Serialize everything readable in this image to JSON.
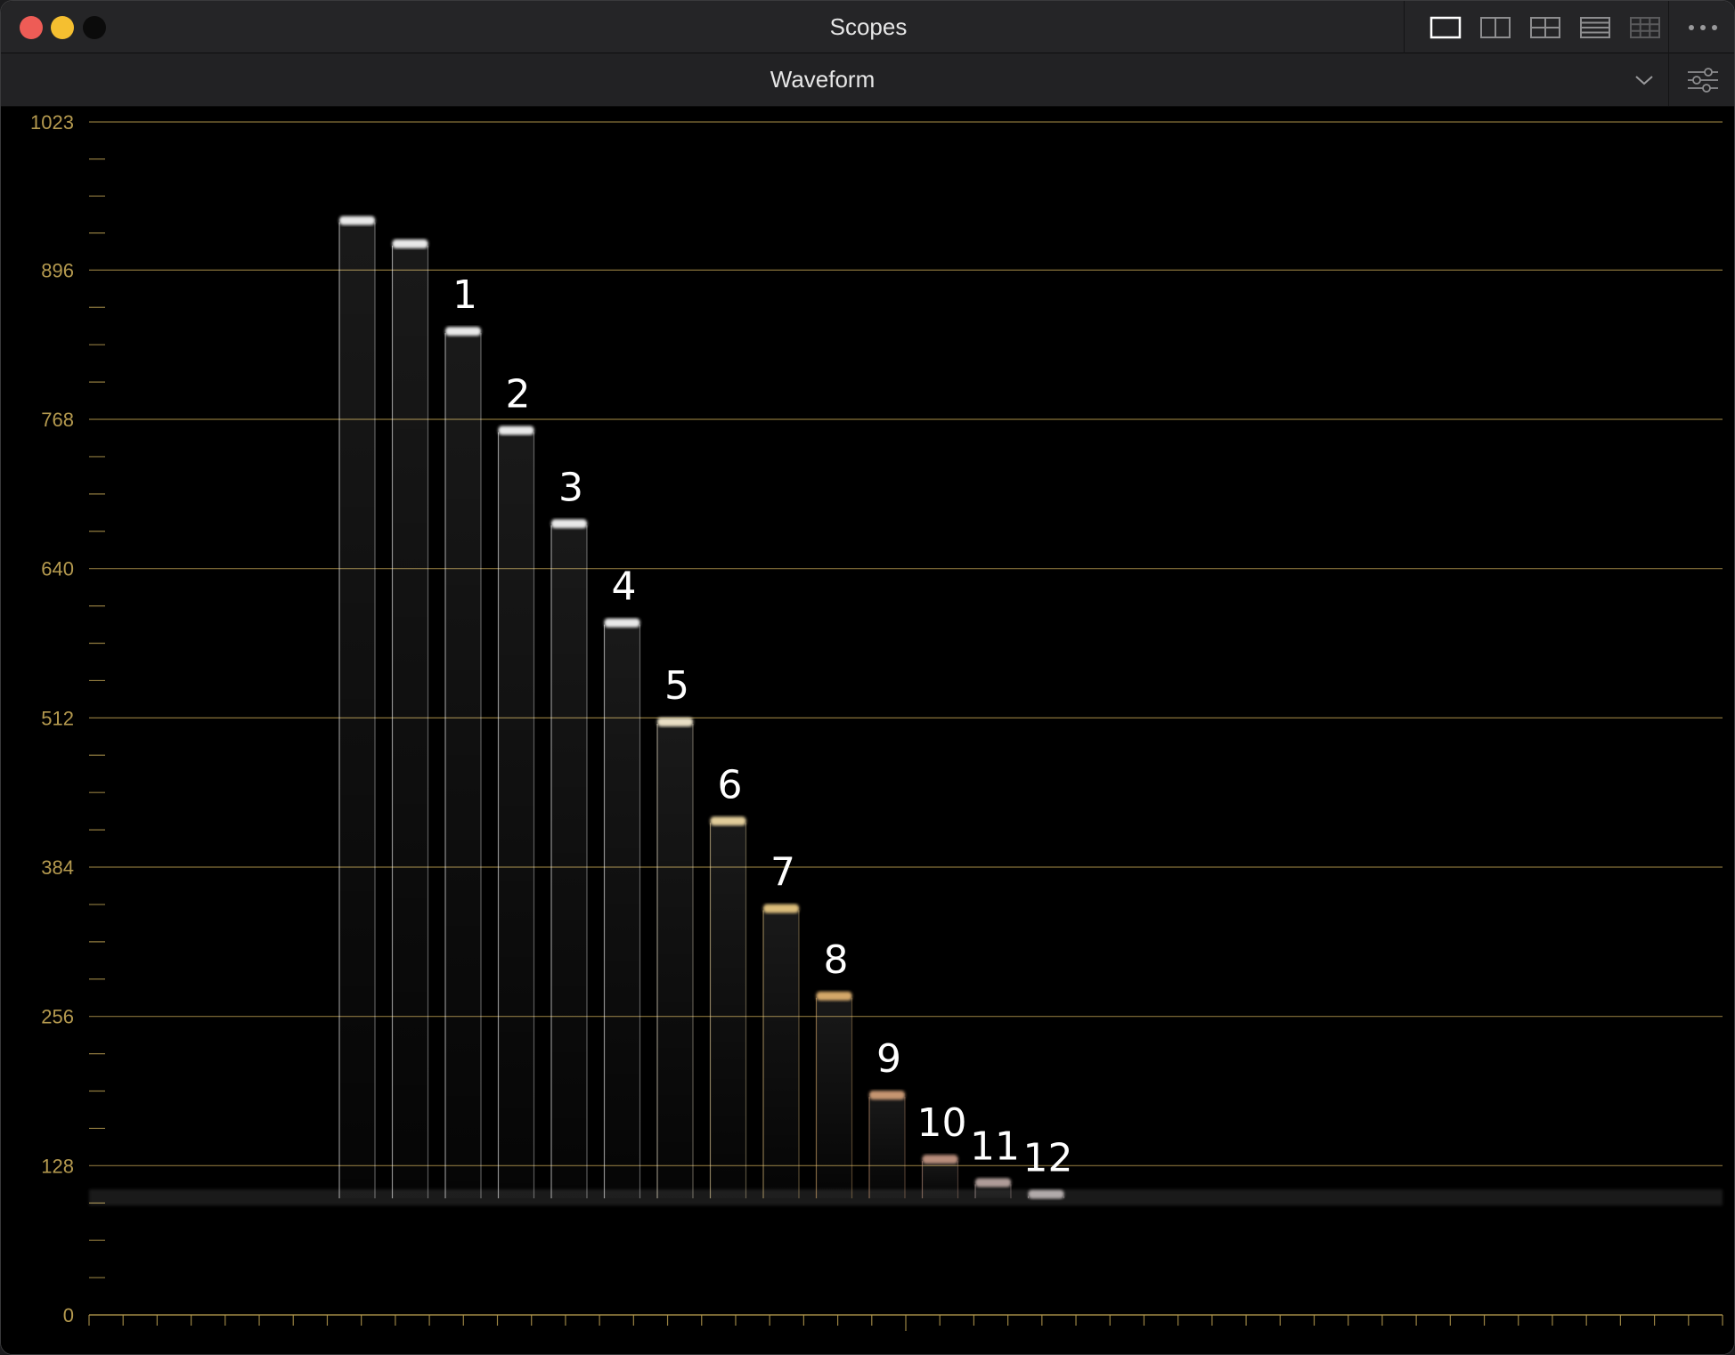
{
  "window": {
    "title": "Scopes"
  },
  "layout_buttons": [
    {
      "name": "layout-single-icon",
      "active": true
    },
    {
      "name": "layout-split-vertical-icon",
      "active": false
    },
    {
      "name": "layout-quad-icon",
      "active": false
    },
    {
      "name": "layout-rows-icon",
      "active": false
    },
    {
      "name": "layout-grid-icon",
      "active": false
    }
  ],
  "toolbar": {
    "scope_type": "Waveform"
  },
  "colors": {
    "graticule": "#b59a4f",
    "trace": "#ffffff"
  },
  "chart_data": {
    "type": "waveform",
    "y_ticks": [
      "1023",
      "896",
      "768",
      "640",
      "512",
      "384",
      "256",
      "128",
      "0"
    ],
    "ylim": [
      0,
      1023
    ],
    "baseline_level": 100,
    "patches": [
      {
        "label": "",
        "level": 940
      },
      {
        "label": "",
        "level": 920
      },
      {
        "label": "1",
        "level": 845
      },
      {
        "label": "2",
        "level": 760
      },
      {
        "label": "3",
        "level": 680
      },
      {
        "label": "4",
        "level": 595
      },
      {
        "label": "5",
        "level": 510
      },
      {
        "label": "6",
        "level": 425
      },
      {
        "label": "7",
        "level": 350
      },
      {
        "label": "8",
        "level": 275
      },
      {
        "label": "9",
        "level": 190
      },
      {
        "label": "10",
        "level": 135
      },
      {
        "label": "11",
        "level": 115
      },
      {
        "label": "12",
        "level": 105
      }
    ]
  }
}
